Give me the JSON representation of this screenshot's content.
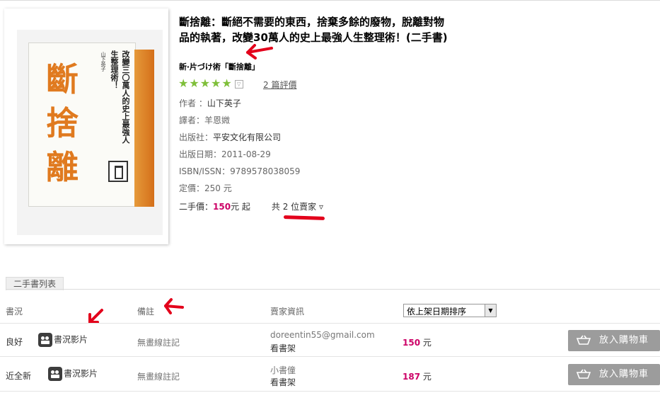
{
  "book": {
    "title": "斷捨離：斷絕不需要的東西，捨棄多餘的廢物，脫離對物品的執著，改變30萬人的史上最強人生整理術！(二手書)",
    "subtitle": "新‧片づけ術「斷捨離」",
    "rating_stars": 5,
    "review_count": "2 篇評價",
    "author_label": "作者 ：",
    "author": "山下英子",
    "translator_label": "譯者：",
    "translator": "羊恩媺",
    "publisher_label": "出版社：",
    "publisher": "平安文化有限公司",
    "pubdate_label": "出版日期：",
    "pubdate": "2011-08-29",
    "isbn_label": "ISBN/ISSN：",
    "isbn": "9789578038059",
    "list_price_label": "定價：",
    "list_price": "250 元",
    "used_price_label": "二手價：",
    "used_price": "150",
    "used_price_suffix": "元  起",
    "seller_count_text": "共 2 位賣家 ▿"
  },
  "cover": {
    "chars": [
      "斷",
      "捨",
      "離"
    ],
    "tagline": "改變三〇萬人的史上最強人生整理術！",
    "author_vertical": "山下英子",
    "colors": {
      "orange": "#e07a1f"
    }
  },
  "list": {
    "section_title": "二手書列表",
    "headers": {
      "condition": "書況",
      "note": "備註",
      "seller": "賣家資訊"
    },
    "sort_value": "依上架日期排序",
    "rows": [
      {
        "condition": "良好",
        "video_label": "書況影片",
        "note": "無畫線註記",
        "seller": "doreentin55@gmail.com",
        "shelf": "看書架",
        "price": "150",
        "price_unit": "元",
        "cart_label": "放入購物車"
      },
      {
        "condition": "近全新",
        "video_label": "書況影片",
        "note": "無畫線註記",
        "seller": "小書僮",
        "shelf": "看書架",
        "price": "187",
        "price_unit": "元",
        "cart_label": "放入購物車"
      }
    ]
  },
  "colors": {
    "price": "#cc0066",
    "annotation": "#e3001b",
    "star": "#7fbf3a",
    "cart": "#9c9c9c"
  }
}
